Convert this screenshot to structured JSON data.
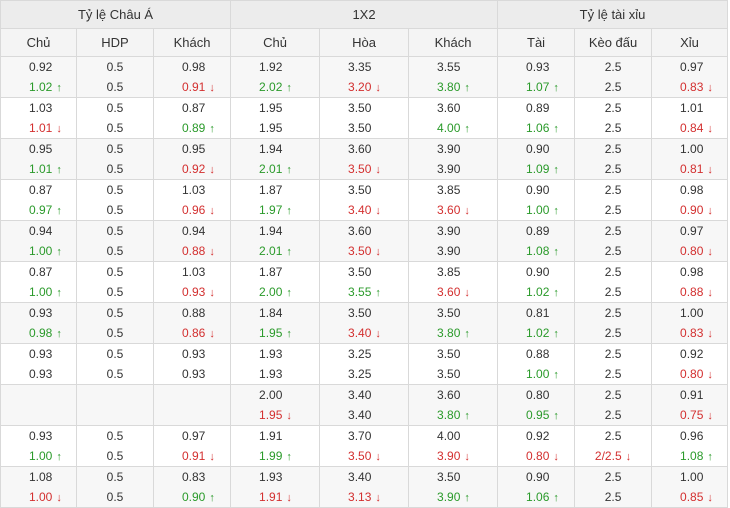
{
  "groups": [
    "Tỷ lệ Châu Á",
    "1X2",
    "Tỷ lệ tài xỉu"
  ],
  "columns": [
    "Chủ",
    "HDP",
    "Khách",
    "Chủ",
    "Hòa",
    "Khách",
    "Tài",
    "Kèo đấu",
    "Xỉu"
  ],
  "rows": [
    {
      "cells": [
        [
          {
            "v": "0.92"
          },
          {
            "v": "1.02",
            "d": "up"
          }
        ],
        [
          {
            "v": "0.5"
          },
          {
            "v": "0.5"
          }
        ],
        [
          {
            "v": "0.98"
          },
          {
            "v": "0.91",
            "d": "down"
          }
        ],
        [
          {
            "v": "1.92"
          },
          {
            "v": "2.02",
            "d": "up"
          }
        ],
        [
          {
            "v": "3.35"
          },
          {
            "v": "3.20",
            "d": "down"
          }
        ],
        [
          {
            "v": "3.55"
          },
          {
            "v": "3.80",
            "d": "up"
          }
        ],
        [
          {
            "v": "0.93"
          },
          {
            "v": "1.07",
            "d": "up"
          }
        ],
        [
          {
            "v": "2.5"
          },
          {
            "v": "2.5"
          }
        ],
        [
          {
            "v": "0.97"
          },
          {
            "v": "0.83",
            "d": "down"
          }
        ]
      ]
    },
    {
      "cells": [
        [
          {
            "v": "1.03"
          },
          {
            "v": "1.01",
            "d": "down"
          }
        ],
        [
          {
            "v": "0.5"
          },
          {
            "v": "0.5"
          }
        ],
        [
          {
            "v": "0.87"
          },
          {
            "v": "0.89",
            "d": "up"
          }
        ],
        [
          {
            "v": "1.95"
          },
          {
            "v": "1.95"
          }
        ],
        [
          {
            "v": "3.50"
          },
          {
            "v": "3.50"
          }
        ],
        [
          {
            "v": "3.60"
          },
          {
            "v": "4.00",
            "d": "up"
          }
        ],
        [
          {
            "v": "0.89"
          },
          {
            "v": "1.06",
            "d": "up"
          }
        ],
        [
          {
            "v": "2.5"
          },
          {
            "v": "2.5"
          }
        ],
        [
          {
            "v": "1.01"
          },
          {
            "v": "0.84",
            "d": "down"
          }
        ]
      ]
    },
    {
      "cells": [
        [
          {
            "v": "0.95"
          },
          {
            "v": "1.01",
            "d": "up"
          }
        ],
        [
          {
            "v": "0.5"
          },
          {
            "v": "0.5"
          }
        ],
        [
          {
            "v": "0.95"
          },
          {
            "v": "0.92",
            "d": "down"
          }
        ],
        [
          {
            "v": "1.94"
          },
          {
            "v": "2.01",
            "d": "up"
          }
        ],
        [
          {
            "v": "3.60"
          },
          {
            "v": "3.50",
            "d": "down"
          }
        ],
        [
          {
            "v": "3.90"
          },
          {
            "v": "3.90"
          }
        ],
        [
          {
            "v": "0.90"
          },
          {
            "v": "1.09",
            "d": "up"
          }
        ],
        [
          {
            "v": "2.5"
          },
          {
            "v": "2.5"
          }
        ],
        [
          {
            "v": "1.00"
          },
          {
            "v": "0.81",
            "d": "down"
          }
        ]
      ]
    },
    {
      "cells": [
        [
          {
            "v": "0.87"
          },
          {
            "v": "0.97",
            "d": "up"
          }
        ],
        [
          {
            "v": "0.5"
          },
          {
            "v": "0.5"
          }
        ],
        [
          {
            "v": "1.03"
          },
          {
            "v": "0.96",
            "d": "down"
          }
        ],
        [
          {
            "v": "1.87"
          },
          {
            "v": "1.97",
            "d": "up"
          }
        ],
        [
          {
            "v": "3.50"
          },
          {
            "v": "3.40",
            "d": "down"
          }
        ],
        [
          {
            "v": "3.85"
          },
          {
            "v": "3.60",
            "d": "down"
          }
        ],
        [
          {
            "v": "0.90"
          },
          {
            "v": "1.00",
            "d": "up"
          }
        ],
        [
          {
            "v": "2.5"
          },
          {
            "v": "2.5"
          }
        ],
        [
          {
            "v": "0.98"
          },
          {
            "v": "0.90",
            "d": "down"
          }
        ]
      ]
    },
    {
      "cells": [
        [
          {
            "v": "0.94"
          },
          {
            "v": "1.00",
            "d": "up"
          }
        ],
        [
          {
            "v": "0.5"
          },
          {
            "v": "0.5"
          }
        ],
        [
          {
            "v": "0.94"
          },
          {
            "v": "0.88",
            "d": "down"
          }
        ],
        [
          {
            "v": "1.94"
          },
          {
            "v": "2.01",
            "d": "up"
          }
        ],
        [
          {
            "v": "3.60"
          },
          {
            "v": "3.50",
            "d": "down"
          }
        ],
        [
          {
            "v": "3.90"
          },
          {
            "v": "3.90"
          }
        ],
        [
          {
            "v": "0.89"
          },
          {
            "v": "1.08",
            "d": "up"
          }
        ],
        [
          {
            "v": "2.5"
          },
          {
            "v": "2.5"
          }
        ],
        [
          {
            "v": "0.97"
          },
          {
            "v": "0.80",
            "d": "down"
          }
        ]
      ]
    },
    {
      "cells": [
        [
          {
            "v": "0.87"
          },
          {
            "v": "1.00",
            "d": "up"
          }
        ],
        [
          {
            "v": "0.5"
          },
          {
            "v": "0.5"
          }
        ],
        [
          {
            "v": "1.03"
          },
          {
            "v": "0.93",
            "d": "down"
          }
        ],
        [
          {
            "v": "1.87"
          },
          {
            "v": "2.00",
            "d": "up"
          }
        ],
        [
          {
            "v": "3.50"
          },
          {
            "v": "3.55",
            "d": "up"
          }
        ],
        [
          {
            "v": "3.85"
          },
          {
            "v": "3.60",
            "d": "down"
          }
        ],
        [
          {
            "v": "0.90"
          },
          {
            "v": "1.02",
            "d": "up"
          }
        ],
        [
          {
            "v": "2.5"
          },
          {
            "v": "2.5"
          }
        ],
        [
          {
            "v": "0.98"
          },
          {
            "v": "0.88",
            "d": "down"
          }
        ]
      ]
    },
    {
      "cells": [
        [
          {
            "v": "0.93"
          },
          {
            "v": "0.98",
            "d": "up"
          }
        ],
        [
          {
            "v": "0.5"
          },
          {
            "v": "0.5"
          }
        ],
        [
          {
            "v": "0.88"
          },
          {
            "v": "0.86",
            "d": "down"
          }
        ],
        [
          {
            "v": "1.84"
          },
          {
            "v": "1.95",
            "d": "up"
          }
        ],
        [
          {
            "v": "3.50"
          },
          {
            "v": "3.40",
            "d": "down"
          }
        ],
        [
          {
            "v": "3.50"
          },
          {
            "v": "3.80",
            "d": "up"
          }
        ],
        [
          {
            "v": "0.81"
          },
          {
            "v": "1.02",
            "d": "up"
          }
        ],
        [
          {
            "v": "2.5"
          },
          {
            "v": "2.5"
          }
        ],
        [
          {
            "v": "1.00"
          },
          {
            "v": "0.83",
            "d": "down"
          }
        ]
      ]
    },
    {
      "cells": [
        [
          {
            "v": "0.93"
          },
          {
            "v": "0.93"
          }
        ],
        [
          {
            "v": "0.5"
          },
          {
            "v": "0.5"
          }
        ],
        [
          {
            "v": "0.93"
          },
          {
            "v": "0.93"
          }
        ],
        [
          {
            "v": "1.93"
          },
          {
            "v": "1.93"
          }
        ],
        [
          {
            "v": "3.25"
          },
          {
            "v": "3.25"
          }
        ],
        [
          {
            "v": "3.50"
          },
          {
            "v": "3.50"
          }
        ],
        [
          {
            "v": "0.88"
          },
          {
            "v": "1.00",
            "d": "up"
          }
        ],
        [
          {
            "v": "2.5"
          },
          {
            "v": "2.5"
          }
        ],
        [
          {
            "v": "0.92"
          },
          {
            "v": "0.80",
            "d": "down"
          }
        ]
      ]
    },
    {
      "cells": [
        [],
        [],
        [],
        [
          {
            "v": "2.00"
          },
          {
            "v": "1.95",
            "d": "down"
          }
        ],
        [
          {
            "v": "3.40"
          },
          {
            "v": "3.40"
          }
        ],
        [
          {
            "v": "3.60"
          },
          {
            "v": "3.80",
            "d": "up"
          }
        ],
        [
          {
            "v": "0.80"
          },
          {
            "v": "0.95",
            "d": "up"
          }
        ],
        [
          {
            "v": "2.5"
          },
          {
            "v": "2.5"
          }
        ],
        [
          {
            "v": "0.91"
          },
          {
            "v": "0.75",
            "d": "down"
          }
        ]
      ]
    },
    {
      "cells": [
        [
          {
            "v": "0.93"
          },
          {
            "v": "1.00",
            "d": "up"
          }
        ],
        [
          {
            "v": "0.5"
          },
          {
            "v": "0.5"
          }
        ],
        [
          {
            "v": "0.97"
          },
          {
            "v": "0.91",
            "d": "down"
          }
        ],
        [
          {
            "v": "1.91"
          },
          {
            "v": "1.99",
            "d": "up"
          }
        ],
        [
          {
            "v": "3.70"
          },
          {
            "v": "3.50",
            "d": "down"
          }
        ],
        [
          {
            "v": "4.00"
          },
          {
            "v": "3.90",
            "d": "down"
          }
        ],
        [
          {
            "v": "0.92"
          },
          {
            "v": "0.80",
            "d": "down"
          }
        ],
        [
          {
            "v": "2.5"
          },
          {
            "v": "2/2.5",
            "d": "down"
          }
        ],
        [
          {
            "v": "0.96"
          },
          {
            "v": "1.08",
            "d": "up"
          }
        ]
      ]
    },
    {
      "cells": [
        [
          {
            "v": "1.08"
          },
          {
            "v": "1.00",
            "d": "down"
          }
        ],
        [
          {
            "v": "0.5"
          },
          {
            "v": "0.5"
          }
        ],
        [
          {
            "v": "0.83"
          },
          {
            "v": "0.90",
            "d": "up"
          }
        ],
        [
          {
            "v": "1.93"
          },
          {
            "v": "1.91",
            "d": "down"
          }
        ],
        [
          {
            "v": "3.40"
          },
          {
            "v": "3.13",
            "d": "down"
          }
        ],
        [
          {
            "v": "3.50"
          },
          {
            "v": "3.90",
            "d": "up"
          }
        ],
        [
          {
            "v": "0.90"
          },
          {
            "v": "1.06",
            "d": "up"
          }
        ],
        [
          {
            "v": "2.5"
          },
          {
            "v": "2.5"
          }
        ],
        [
          {
            "v": "1.00"
          },
          {
            "v": "0.85",
            "d": "down"
          }
        ]
      ]
    }
  ],
  "colors": {
    "up": "#2a9a2a",
    "down": "#d32f2f"
  },
  "icons": {
    "up": "arrow-up-icon",
    "down": "arrow-down-icon"
  }
}
